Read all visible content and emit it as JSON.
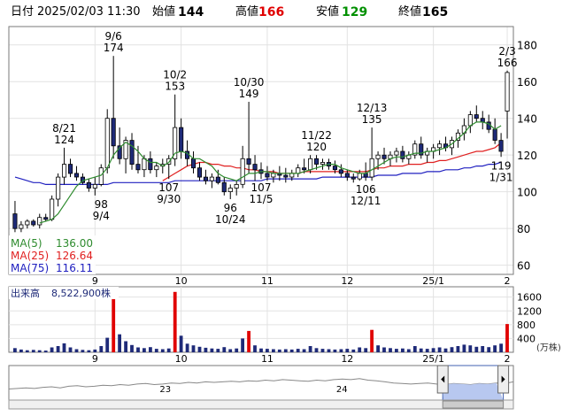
{
  "header": {
    "date_label": "日付",
    "datetime": "2025/02/03 11:30",
    "open_label": "始値",
    "open": "144",
    "high_label": "高値",
    "high": "166",
    "low_label": "安値",
    "low": "129",
    "close_label": "終値",
    "close": "165",
    "high_color": "#e00000",
    "low_color": "#009000"
  },
  "colors": {
    "up": "#ffffff",
    "down": "#1e2a78",
    "candle_outline": "#000000",
    "ma5": "#2e8b2e",
    "ma25": "#e02020",
    "ma75": "#2020c0",
    "volume": "#1e2a78",
    "volume_highlight": "#e00000",
    "navigator_fill": "#b8c8f0"
  },
  "chart_data": [
    {
      "type": "candlestick",
      "title": "",
      "ylim": [
        55,
        190
      ],
      "y_ticks": [
        60,
        80,
        100,
        120,
        140,
        160,
        180
      ],
      "x_ticks": [
        {
          "label": "9",
          "index": 13
        },
        {
          "label": "10",
          "index": 27
        },
        {
          "label": "11",
          "index": 41
        },
        {
          "label": "12",
          "index": 54
        },
        {
          "label": "25/1",
          "index": 68
        },
        {
          "label": "2",
          "index": 80
        }
      ],
      "legend": [
        {
          "name": "MA(5)",
          "value": "136.00",
          "color": "#2e8b2e"
        },
        {
          "name": "MA(25)",
          "value": "126.64",
          "color": "#e02020"
        },
        {
          "name": "MA(75)",
          "value": "116.11",
          "color": "#2020c0"
        }
      ],
      "annotations": [
        {
          "date": "8/21",
          "value": "124",
          "index": 8,
          "y": 124,
          "pos": "above"
        },
        {
          "date": "9/6",
          "value": "174",
          "index": 16,
          "y": 174,
          "pos": "above"
        },
        {
          "date": "9/4",
          "value": "98",
          "index": 14,
          "y": 98,
          "pos": "below"
        },
        {
          "date": "10/2",
          "value": "153",
          "index": 26,
          "y": 153,
          "pos": "above"
        },
        {
          "date": "9/30",
          "value": "107",
          "index": 25,
          "y": 107,
          "pos": "below"
        },
        {
          "date": "10/30",
          "value": "149",
          "index": 38,
          "y": 149,
          "pos": "above"
        },
        {
          "date": "10/24",
          "value": "96",
          "index": 35,
          "y": 96,
          "pos": "below"
        },
        {
          "date": "11/5",
          "value": "107",
          "index": 40,
          "y": 107,
          "pos": "below"
        },
        {
          "date": "11/22",
          "value": "120",
          "index": 49,
          "y": 120,
          "pos": "above"
        },
        {
          "date": "12/13",
          "value": "135",
          "index": 58,
          "y": 135,
          "pos": "above"
        },
        {
          "date": "12/11",
          "value": "106",
          "index": 57,
          "y": 106,
          "pos": "below"
        },
        {
          "date": "2/3",
          "value": "166",
          "index": 80,
          "y": 166,
          "pos": "above"
        },
        {
          "date": "1/31",
          "value": "119",
          "index": 79,
          "y": 119,
          "pos": "below"
        }
      ],
      "ohlc": [
        [
          88,
          95,
          78,
          80
        ],
        [
          80,
          84,
          78,
          82
        ],
        [
          82,
          85,
          80,
          84
        ],
        [
          84,
          85,
          81,
          82
        ],
        [
          82,
          88,
          80,
          86
        ],
        [
          86,
          88,
          84,
          85
        ],
        [
          85,
          98,
          84,
          96
        ],
        [
          96,
          110,
          92,
          108
        ],
        [
          108,
          124,
          104,
          115
        ],
        [
          115,
          118,
          108,
          110
        ],
        [
          110,
          114,
          106,
          108
        ],
        [
          108,
          110,
          104,
          105
        ],
        [
          105,
          107,
          100,
          102
        ],
        [
          102,
          108,
          98,
          104
        ],
        [
          104,
          115,
          103,
          113
        ],
        [
          113,
          145,
          110,
          140
        ],
        [
          140,
          174,
          118,
          125
        ],
        [
          125,
          135,
          115,
          118
        ],
        [
          118,
          130,
          110,
          128
        ],
        [
          128,
          132,
          112,
          115
        ],
        [
          115,
          125,
          110,
          112
        ],
        [
          112,
          120,
          108,
          118
        ],
        [
          118,
          122,
          110,
          112
        ],
        [
          112,
          116,
          108,
          114
        ],
        [
          114,
          118,
          110,
          115
        ],
        [
          115,
          120,
          107,
          118
        ],
        [
          118,
          153,
          114,
          135
        ],
        [
          135,
          140,
          118,
          122
        ],
        [
          122,
          128,
          114,
          118
        ],
        [
          118,
          122,
          110,
          113
        ],
        [
          113,
          116,
          106,
          108
        ],
        [
          108,
          112,
          104,
          106
        ],
        [
          106,
          110,
          102,
          108
        ],
        [
          108,
          112,
          104,
          105
        ],
        [
          105,
          108,
          98,
          100
        ],
        [
          100,
          104,
          96,
          102
        ],
        [
          102,
          106,
          98,
          104
        ],
        [
          104,
          125,
          102,
          118
        ],
        [
          118,
          149,
          110,
          115
        ],
        [
          115,
          120,
          106,
          112
        ],
        [
          112,
          116,
          107,
          110
        ],
        [
          110,
          114,
          106,
          108
        ],
        [
          108,
          112,
          105,
          110
        ],
        [
          110,
          114,
          106,
          109
        ],
        [
          109,
          113,
          105,
          108
        ],
        [
          108,
          112,
          106,
          110
        ],
        [
          110,
          115,
          108,
          113
        ],
        [
          113,
          118,
          110,
          112
        ],
        [
          112,
          120,
          110,
          118
        ],
        [
          118,
          120,
          112,
          115
        ],
        [
          115,
          118,
          112,
          116
        ],
        [
          116,
          118,
          112,
          114
        ],
        [
          114,
          117,
          110,
          112
        ],
        [
          112,
          115,
          108,
          110
        ],
        [
          110,
          112,
          106,
          108
        ],
        [
          108,
          110,
          105,
          107
        ],
        [
          107,
          112,
          106,
          110
        ],
        [
          110,
          116,
          106,
          108
        ],
        [
          108,
          135,
          106,
          118
        ],
        [
          118,
          122,
          112,
          120
        ],
        [
          120,
          124,
          115,
          118
        ],
        [
          118,
          122,
          114,
          120
        ],
        [
          120,
          124,
          116,
          122
        ],
        [
          122,
          125,
          116,
          118
        ],
        [
          118,
          122,
          115,
          120
        ],
        [
          120,
          128,
          118,
          126
        ],
        [
          126,
          130,
          118,
          120
        ],
        [
          120,
          124,
          116,
          122
        ],
        [
          122,
          126,
          118,
          124
        ],
        [
          124,
          128,
          120,
          126
        ],
        [
          126,
          130,
          122,
          124
        ],
        [
          124,
          130,
          120,
          128
        ],
        [
          128,
          134,
          124,
          132
        ],
        [
          132,
          140,
          128,
          136
        ],
        [
          136,
          144,
          132,
          142
        ],
        [
          142,
          147,
          138,
          140
        ],
        [
          140,
          144,
          134,
          138
        ],
        [
          138,
          142,
          132,
          134
        ],
        [
          134,
          140,
          126,
          128
        ],
        [
          128,
          132,
          119,
          122
        ],
        [
          144,
          166,
          129,
          165
        ]
      ],
      "ma5": [
        null,
        null,
        null,
        null,
        83,
        84,
        85,
        88,
        93,
        98,
        103,
        106,
        107,
        108,
        109,
        113,
        120,
        124,
        127,
        125,
        122,
        118,
        116,
        116,
        114,
        116,
        121,
        122,
        121,
        118,
        118,
        116,
        114,
        110,
        108,
        107,
        106,
        108,
        110,
        110,
        111,
        111,
        110,
        110,
        110,
        110,
        110,
        111,
        112,
        113,
        114,
        115,
        115,
        113,
        112,
        111,
        110,
        110,
        112,
        114,
        116,
        118,
        119,
        119,
        120,
        121,
        121,
        122,
        122,
        123,
        124,
        126,
        129,
        132,
        136,
        138,
        138,
        137,
        134,
        136
      ],
      "ma25": [
        null,
        null,
        null,
        null,
        null,
        null,
        null,
        null,
        null,
        null,
        null,
        null,
        null,
        null,
        null,
        null,
        null,
        null,
        null,
        null,
        null,
        null,
        null,
        null,
        106,
        108,
        110,
        112,
        114,
        115,
        116,
        116,
        115,
        115,
        114,
        114,
        113,
        113,
        112,
        112,
        111,
        111,
        111,
        110,
        110,
        110,
        110,
        111,
        111,
        111,
        111,
        111,
        111,
        111,
        111,
        111,
        111,
        111,
        112,
        113,
        113,
        114,
        114,
        114,
        115,
        115,
        115,
        116,
        116,
        117,
        117,
        118,
        119,
        120,
        121,
        122,
        122,
        123,
        124,
        126.64
      ],
      "ma75": [
        108,
        107,
        106,
        105,
        105,
        104,
        104,
        104,
        104,
        104,
        104,
        104,
        104,
        104,
        104,
        104,
        105,
        105,
        105,
        105,
        105,
        105,
        105,
        105,
        105,
        105,
        106,
        106,
        106,
        106,
        106,
        106,
        106,
        106,
        106,
        106,
        106,
        106,
        106,
        106,
        106,
        107,
        107,
        107,
        107,
        107,
        107,
        107,
        107,
        107,
        108,
        108,
        108,
        108,
        108,
        108,
        108,
        108,
        108,
        109,
        109,
        109,
        109,
        110,
        110,
        110,
        110,
        111,
        111,
        111,
        112,
        112,
        112,
        113,
        113,
        114,
        114,
        115,
        115,
        116.11
      ]
    },
    {
      "type": "bar",
      "title": "",
      "label": "出来高",
      "value": "8,522,900株",
      "unit": "(万株)",
      "ylim": [
        0,
        1900
      ],
      "y_ticks": [
        400,
        800,
        1200,
        1600
      ],
      "values": [
        120,
        80,
        60,
        70,
        60,
        50,
        140,
        180,
        260,
        140,
        90,
        70,
        60,
        80,
        180,
        420,
        1650,
        520,
        320,
        210,
        140,
        120,
        150,
        100,
        90,
        110,
        1750,
        480,
        250,
        200,
        160,
        130,
        110,
        100,
        150,
        90,
        110,
        400,
        620,
        200,
        110,
        100,
        90,
        80,
        90,
        80,
        100,
        90,
        180,
        120,
        100,
        90,
        80,
        90,
        100,
        80,
        140,
        120,
        650,
        200,
        140,
        120,
        100,
        110,
        90,
        180,
        110,
        100,
        120,
        140,
        110,
        150,
        180,
        220,
        200,
        160,
        180,
        150,
        200,
        250,
        820
      ],
      "highlight": [
        16,
        26,
        38,
        58,
        80
      ]
    }
  ],
  "navigator": {
    "labels": [
      {
        "label": "23",
        "pos": 0.31
      },
      {
        "label": "24",
        "pos": 0.66
      },
      {
        "label": "2",
        "pos": 0.985
      }
    ],
    "profile": [
      0.2,
      0.21,
      0.22,
      0.21,
      0.23,
      0.24,
      0.22,
      0.25,
      0.26,
      0.24,
      0.25,
      0.27,
      0.26,
      0.28,
      0.27,
      0.29,
      0.3,
      0.28,
      0.29,
      0.31,
      0.3,
      0.32,
      0.31,
      0.33,
      0.32,
      0.33,
      0.34,
      0.33,
      0.35,
      0.34,
      0.36,
      0.35,
      0.37,
      0.36,
      0.35,
      0.34,
      0.36,
      0.35,
      0.37,
      0.38,
      0.37,
      0.39,
      0.36,
      0.35,
      0.33,
      0.31,
      0.3,
      0.29,
      0.3,
      0.31,
      0.29,
      0.28,
      0.3,
      0.29,
      0.28,
      0.3,
      0.29,
      0.31,
      0.3,
      0.33
    ],
    "window_start": 0.86,
    "window_end": 0.98
  }
}
